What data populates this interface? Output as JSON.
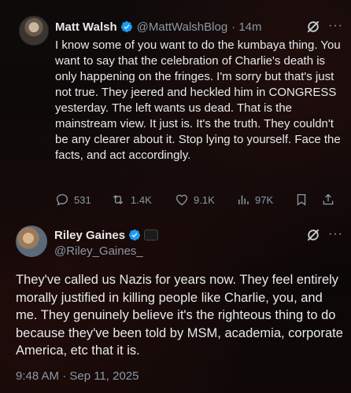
{
  "tweet1": {
    "author_name": "Matt Walsh",
    "handle": "@MattWalshBlog",
    "time": "· 14m",
    "more": "···",
    "text": "I know some of you want to do the kumbaya thing. You want to say that the celebration of Charlie's death is only happening on the fringes. I'm sorry but that's just not true. They jeered and heckled him in CONGRESS yesterday. The left wants us dead. That is the mainstream view. It just is. It's the truth. They couldn't be any clearer about it. Stop lying to yourself. Face the facts, and act accordingly.",
    "actions": {
      "replies": "531",
      "reposts": "1.4K",
      "likes": "9.1K",
      "views": "97K"
    }
  },
  "tweet2": {
    "author_name": "Riley Gaines",
    "handle": "@Riley_Gaines_",
    "more": "···",
    "text": "They've called us Nazis for years now. They feel entirely morally justified in killing people like Charlie, you, and me. They genuinely believe it's the righteous thing to do because they've been told by MSM, academia, corporate America, etc that it is.",
    "timestamp": "9:48 AM · Sep 11, 2025"
  },
  "colors": {
    "verified": "#1d9bf0",
    "muted": "#8b98a5",
    "text": "#e7e9ea"
  },
  "icons": [
    "grok-icon",
    "more-icon",
    "reply-icon",
    "repost-icon",
    "like-icon",
    "views-icon",
    "bookmark-icon",
    "share-icon",
    "verified-icon"
  ]
}
